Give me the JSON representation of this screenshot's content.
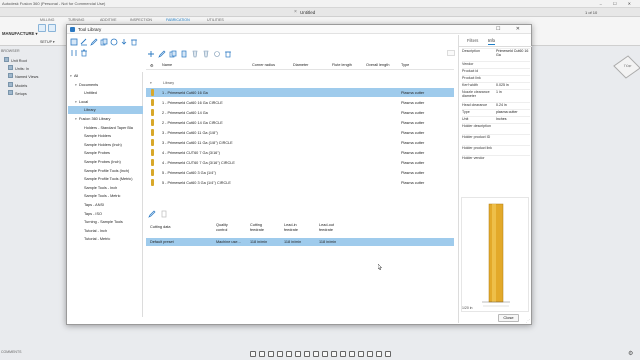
{
  "app": {
    "window_title": "Autodesk Fusion 360 (Personal - Not for Commercial Use)",
    "document_name": "Untitled",
    "page_indicator": "1 of 10",
    "ribbon_tabs": [
      "MILLING",
      "TURNING",
      "ADDITIVE",
      "INSPECTION",
      "FABRICATION",
      "UTILITIES"
    ],
    "active_ribbon_tab": "FABRICATION",
    "workspace": "MANUFACTURE",
    "setup_label": "SETUP",
    "browser_title": "BROWSER",
    "browser_items": [
      "Unit Root",
      "Units: In",
      "Named Views",
      "Models",
      "Setups"
    ],
    "viewcube_label": "TOP",
    "comments_label": "COMMENTS"
  },
  "dialog": {
    "title": "Tool Library",
    "tree": [
      {
        "label": "All",
        "level": 0,
        "expanded": true
      },
      {
        "label": "Documents",
        "level": 1,
        "expanded": true
      },
      {
        "label": "Untitled",
        "level": 2
      },
      {
        "label": "Local",
        "level": 1,
        "expanded": true
      },
      {
        "label": "Library",
        "level": 2,
        "selected": true
      },
      {
        "label": "Fusion 360 Library",
        "level": 1,
        "expanded": true
      },
      {
        "label": "Holders - Standard Taper Bla",
        "level": 2
      },
      {
        "label": "Sample Holders",
        "level": 2
      },
      {
        "label": "Sample Holders (Inch)",
        "level": 2
      },
      {
        "label": "Sample Probes",
        "level": 2
      },
      {
        "label": "Sample Probes (Inch)",
        "level": 2
      },
      {
        "label": "Sample Profile Tools (Inch)",
        "level": 2
      },
      {
        "label": "Sample Profile Tools (Metric)",
        "level": 2
      },
      {
        "label": "Sample Tools - Inch",
        "level": 2
      },
      {
        "label": "Sample Tools - Metric",
        "level": 2
      },
      {
        "label": "Taps - ANSI",
        "level": 2
      },
      {
        "label": "Taps - ISO",
        "level": 2
      },
      {
        "label": "Turning - Sample Tools",
        "level": 2
      },
      {
        "label": "Tutorial - Inch",
        "level": 2
      },
      {
        "label": "Tutorial - Metric",
        "level": 2
      }
    ],
    "columns": [
      "Name",
      "Corner radius",
      "Diameter",
      "Flute length",
      "Overall length",
      "Type"
    ],
    "section_label": "Library",
    "tools": [
      {
        "name": "1 - Primeweld Cut60 16 Ga",
        "type": "Plasma cutter",
        "selected": true
      },
      {
        "name": "1 - Primeweld Cut60 16 Ga CIRCLE",
        "type": "Plasma cutter"
      },
      {
        "name": "2 - Primeweld Cut60 14 Ga",
        "type": "Plasma cutter"
      },
      {
        "name": "2 - Primeweld Cut60 14 Ga CIRCLE",
        "type": "Plasma cutter"
      },
      {
        "name": "3 - Primeweld Cut60 11 Ga (1/8\")",
        "type": "Plasma cutter"
      },
      {
        "name": "3 - Primeweld Cut60 11 Ga (1/8\") CIRCLE",
        "type": "Plasma cutter"
      },
      {
        "name": "4 - Primeweld CUT60 7 Ga (3/16\")",
        "type": "Plasma cutter"
      },
      {
        "name": "4 - Primeweld CUT60 7 Ga (3/16\") CIRCLE",
        "type": "Plasma cutter"
      },
      {
        "name": "5 - Primeweld Cut60 3 Ga (1/4\")",
        "type": "Plasma cutter"
      },
      {
        "name": "5 - Primeweld Cut60 3 Ga (1/4\") CIRCLE",
        "type": "Plasma cutter"
      }
    ],
    "preset_columns": [
      {
        "line1": "Cutting data",
        "line2": ""
      },
      {
        "line1": "Quality",
        "line2": "control"
      },
      {
        "line1": "Cutting",
        "line2": "feedrate"
      },
      {
        "line1": "Lead-in",
        "line2": "feedrate"
      },
      {
        "line1": "Lead-out",
        "line2": "feedrate"
      }
    ],
    "preset_row": [
      "Default preset",
      "Machine use...",
      "118 in/min",
      "118 in/min",
      "118 in/min"
    ],
    "props_tabs": [
      "Filters",
      "Info"
    ],
    "props_active_tab": "Info",
    "properties": [
      {
        "key": "Description",
        "value": "Primeweld Cut60 16 Ga"
      },
      {
        "key": "Vendor",
        "value": ""
      },
      {
        "key": "Product id",
        "value": ""
      },
      {
        "key": "Product link",
        "value": ""
      },
      {
        "key": "Kerf width",
        "value": "0.025 in"
      },
      {
        "key": "Nozzle clearance diameter",
        "value": "1 in"
      },
      {
        "key": "Head clearance",
        "value": "0.24 in"
      },
      {
        "key": "Type",
        "value": "plasma cutter"
      },
      {
        "key": "Unit",
        "value": "Inches"
      },
      {
        "key": "Holder description",
        "value": ""
      },
      {
        "key": "Holder product ID",
        "value": ""
      },
      {
        "key": "Holder product link",
        "value": ""
      },
      {
        "key": "Holder vendor",
        "value": ""
      }
    ],
    "preview_scale": "1/20 in",
    "close_label": "Close"
  },
  "colors": {
    "selection": "#9fcbec",
    "accent": "#1e7fc8",
    "tool_fill": "#e3a92a"
  }
}
